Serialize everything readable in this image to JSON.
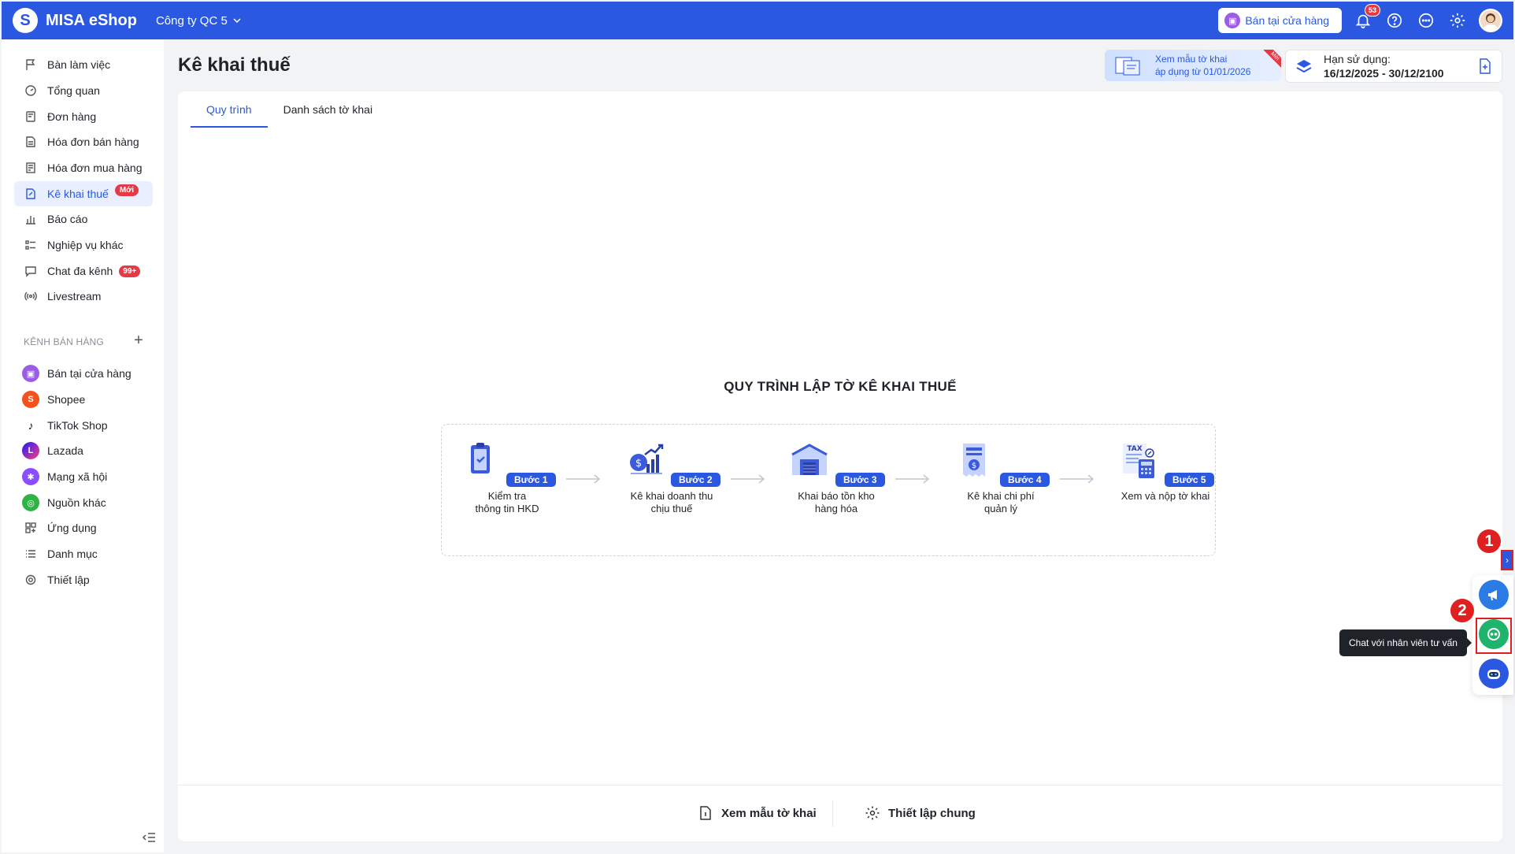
{
  "header": {
    "brand": "MISA eShop",
    "company": "Công ty QC 5",
    "store_button": "Bán tại cửa hàng",
    "notification_count": "53"
  },
  "sidebar": {
    "items": [
      {
        "label": "Bàn làm việc",
        "icon": "flag-icon"
      },
      {
        "label": "Tổng quan",
        "icon": "dashboard-icon"
      },
      {
        "label": "Đơn hàng",
        "icon": "order-icon"
      },
      {
        "label": "Hóa đơn bán hàng",
        "icon": "invoice-icon"
      },
      {
        "label": "Hóa đơn mua hàng",
        "icon": "purchase-invoice-icon"
      },
      {
        "label": "Kê khai thuế",
        "icon": "tax-doc-icon",
        "badge": "Mới"
      },
      {
        "label": "Báo cáo",
        "icon": "report-icon"
      },
      {
        "label": "Nghiệp vụ khác",
        "icon": "list-icon"
      },
      {
        "label": "Chat đa kênh",
        "icon": "chat-icon",
        "badge": "99+"
      },
      {
        "label": "Livestream",
        "icon": "livestream-icon"
      }
    ],
    "channels_label": "KÊNH BÁN HÀNG",
    "channels": [
      {
        "label": "Bán tại cửa hàng",
        "icon": "store-icon"
      },
      {
        "label": "Shopee",
        "icon": "shopee-icon"
      },
      {
        "label": "TikTok Shop",
        "icon": "tiktok-icon"
      },
      {
        "label": "Lazada",
        "icon": "lazada-icon"
      },
      {
        "label": "Mạng xã hội",
        "icon": "social-icon"
      },
      {
        "label": "Nguồn khác",
        "icon": "other-source-icon"
      },
      {
        "label": "Ứng dụng",
        "icon": "apps-icon"
      },
      {
        "label": "Danh mục",
        "icon": "catalog-icon"
      },
      {
        "label": "Thiết lập",
        "icon": "settings-icon"
      }
    ]
  },
  "main": {
    "title": "Kê khai thuế",
    "promo": {
      "line1": "Xem mẫu tờ khai",
      "line2": "áp dụng từ 01/01/2026",
      "ribbon": "Mới"
    },
    "expiry": {
      "label": "Hạn sử dụng:",
      "value": "16/12/2025 - 30/12/2100"
    },
    "tabs": [
      "Quy trình",
      "Danh sách tờ khai"
    ],
    "flow_title": "QUY TRÌNH LẬP TỜ KÊ KHAI THUẾ",
    "steps": [
      {
        "label": "Bước 1",
        "line1": "Kiểm tra",
        "line2": "thông tin HKD"
      },
      {
        "label": "Bước 2",
        "line1": "Kê khai doanh thu",
        "line2": "chịu thuế"
      },
      {
        "label": "Bước 3",
        "line1": "Khai báo tồn kho",
        "line2": "hàng hóa"
      },
      {
        "label": "Bước 4",
        "line1": "Kê khai chi phí",
        "line2": "quản lý"
      },
      {
        "label": "Bước 5",
        "line1": "Xem và nộp tờ khai",
        "line2": ""
      }
    ],
    "footer": {
      "view_template": "Xem mẫu tờ khai",
      "settings": "Thiết lập chung"
    }
  },
  "floating": {
    "tooltip": "Chat với nhân viên tư vấn",
    "marker1": "1",
    "marker2": "2"
  },
  "colors": {
    "primary": "#2a58e0",
    "danger": "#e63946",
    "chat_green": "#1fb36b"
  }
}
